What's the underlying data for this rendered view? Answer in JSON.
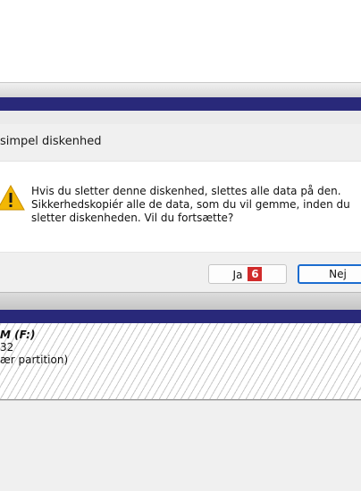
{
  "dialog": {
    "title": "simpel diskenhed",
    "message_lines": [
      "Hvis du sletter denne diskenhed, slettes alle data på den.",
      "Sikkerhedskopiér alle de data, som du vil gemme, inden du",
      "sletter diskenheden. Vil du fortsætte?"
    ],
    "yes_label": "Ja",
    "no_label": "Nej",
    "step_badge": "6",
    "icon": "warning-icon"
  },
  "volume": {
    "name": "M  (F:)",
    "size": "32",
    "type": "ær partition)"
  },
  "colors": {
    "title_band": "#29297a",
    "accent_focus": "#1b6ccf",
    "badge": "#d12b2b",
    "warning": "#f2b705"
  }
}
